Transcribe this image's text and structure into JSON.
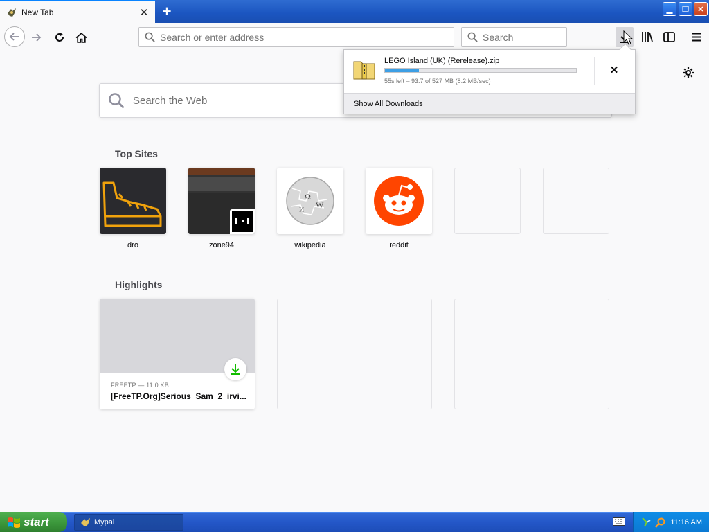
{
  "tab": {
    "title": "New Tab"
  },
  "urlbar": {
    "placeholder": "Search or enter address"
  },
  "searchbar": {
    "placeholder": "Search"
  },
  "websearch": {
    "placeholder": "Search the Web"
  },
  "top_sites": {
    "heading": "Top Sites",
    "items": [
      {
        "label": "dro"
      },
      {
        "label": "zone94"
      },
      {
        "label": "wikipedia"
      },
      {
        "label": "reddit"
      },
      {
        "label": ""
      },
      {
        "label": ""
      }
    ]
  },
  "highlights": {
    "heading": "Highlights",
    "cards": [
      {
        "meta": "FREETP — 11.0 KB",
        "title": "[FreeTP.Org]Serious_Sam_2_irvi..."
      }
    ]
  },
  "downloads": {
    "filename": "LEGO Island (UK) (Rerelease).zip",
    "status": "55s left – 93.7 of 527 MB (8.2 MB/sec)",
    "progress_fraction": 0.178,
    "show_all": "Show All Downloads"
  },
  "taskbar": {
    "start_label": "start",
    "task_label": "Mypal",
    "clock": "11:16 AM"
  },
  "colors": {
    "accent": "#0a84ff",
    "progress": "#3d9fe5",
    "reddit": "#ff4500",
    "download_badge": "#12bc00",
    "xp_taskbar": "#2457c8"
  }
}
